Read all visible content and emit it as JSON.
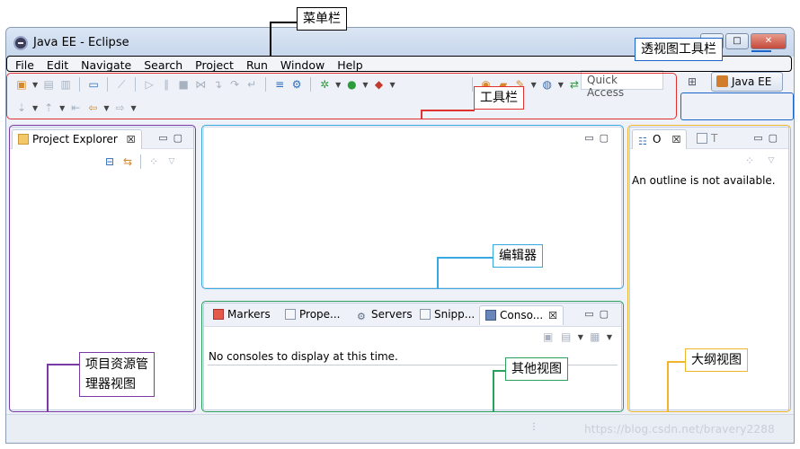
{
  "window": {
    "title": "Java EE - Eclipse"
  },
  "menu": [
    "File",
    "Edit",
    "Navigate",
    "Search",
    "Project",
    "Run",
    "Window",
    "Help"
  ],
  "toolbar": {
    "quick_access": "Quick Access",
    "perspective_label": "Java EE"
  },
  "project_explorer": {
    "tab_label": "Project Explorer",
    "close_glyph": "☒",
    "min_glyph": "▭",
    "max_glyph": "▢"
  },
  "editor": {},
  "console_area": {
    "tabs": [
      "Markers",
      "Prope...",
      "Servers",
      "Snipp...",
      "Conso..."
    ],
    "active_tab_index": 4,
    "message": "No consoles to display at this time."
  },
  "outline": {
    "tab_label": "O",
    "second_tab": "T",
    "message": "An outline is not available."
  },
  "annotations": {
    "menubar": "菜单栏",
    "toolbar": "工具栏",
    "perspective_toolbar": "透视图工具栏",
    "editor": "编辑器",
    "project_explorer_line1": "项目资源管",
    "project_explorer_line2": "理器视图",
    "other_views": "其他视图",
    "outline_view": "大纲视图"
  },
  "watermark": "https://blog.csdn.net/bravery2288",
  "colors": {
    "menubar_ann": "#000000",
    "toolbar_ann": "#e03030",
    "perspective_ann": "#1a63c8",
    "editor_ann": "#35a9e0",
    "explorer_ann": "#7a3aa6",
    "other_ann": "#2aa05a",
    "outline_ann": "#f0b62b"
  }
}
